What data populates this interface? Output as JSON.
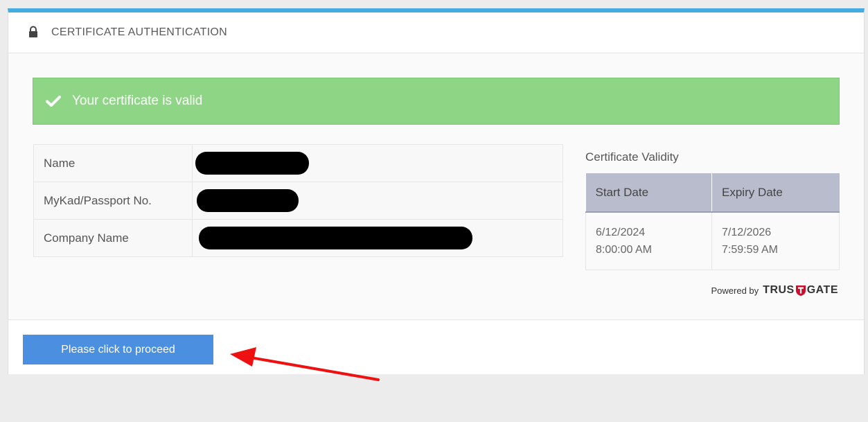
{
  "panel": {
    "title": "CERTIFICATE AUTHENTICATION",
    "accent_color": "#44ace0"
  },
  "alert": {
    "message": "Your certificate is valid",
    "color": "#8fd586"
  },
  "info_table": {
    "rows": [
      {
        "label": "Name"
      },
      {
        "label": "MyKad/Passport No."
      },
      {
        "label": "Company Name"
      }
    ]
  },
  "validity": {
    "title": "Certificate Validity",
    "start_header": "Start Date",
    "expiry_header": "Expiry Date",
    "start_date": "6/12/2024",
    "start_time": "8:00:00 AM",
    "expiry_date": "7/12/2026",
    "expiry_time": "7:59:59 AM"
  },
  "powered": {
    "prefix": "Powered by",
    "brand_left": "TRUS",
    "brand_right": "GATE"
  },
  "footer": {
    "proceed_label": "Please click to proceed",
    "button_color": "#4a8fe0"
  },
  "annotation": {
    "arrow_color": "#ee1111"
  }
}
